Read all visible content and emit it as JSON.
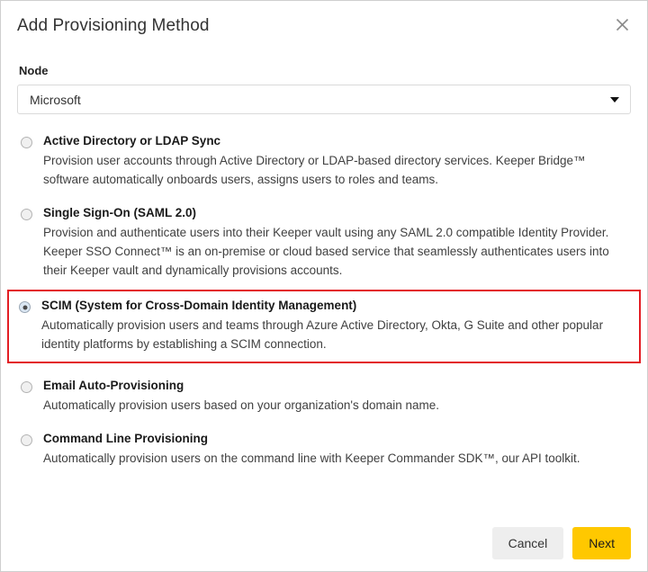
{
  "dialog": {
    "title": "Add Provisioning Method",
    "close_icon": "close-icon"
  },
  "node_field": {
    "label": "Node",
    "selected_value": "Microsoft",
    "caret_icon": "chevron-down-icon"
  },
  "options": [
    {
      "id": "active-directory-ldap-sync",
      "title": "Active Directory or LDAP Sync",
      "description": "Provision user accounts through Active Directory or LDAP-based directory services. Keeper Bridge™ software automatically onboards users, assigns users to roles and teams.",
      "selected": false,
      "highlighted": false
    },
    {
      "id": "single-sign-on-saml",
      "title": "Single Sign-On (SAML 2.0)",
      "description": "Provision and authenticate users into their Keeper vault using any SAML 2.0 compatible Identity Provider. Keeper SSO Connect™ is an on-premise or cloud based service that seamlessly authenticates users into their Keeper vault and dynamically provisions accounts.",
      "selected": false,
      "highlighted": false
    },
    {
      "id": "scim",
      "title": "SCIM (System for Cross-Domain Identity Management)",
      "description": "Automatically provision users and teams through Azure Active Directory, Okta, G Suite and other popular identity platforms by establishing a SCIM connection.",
      "selected": true,
      "highlighted": true
    },
    {
      "id": "email-auto-provisioning",
      "title": "Email Auto-Provisioning",
      "description": "Automatically provision users based on your organization's domain name.",
      "selected": false,
      "highlighted": false
    },
    {
      "id": "command-line-provisioning",
      "title": "Command Line Provisioning",
      "description": "Automatically provision users on the command line with Keeper Commander SDK™, our API toolkit.",
      "selected": false,
      "highlighted": false
    }
  ],
  "footer": {
    "cancel_label": "Cancel",
    "next_label": "Next"
  },
  "colors": {
    "highlight_border": "#e31e24",
    "next_button": "#ffc800",
    "cancel_button": "#eeeeee",
    "dialog_border": "#cfcfcf"
  }
}
